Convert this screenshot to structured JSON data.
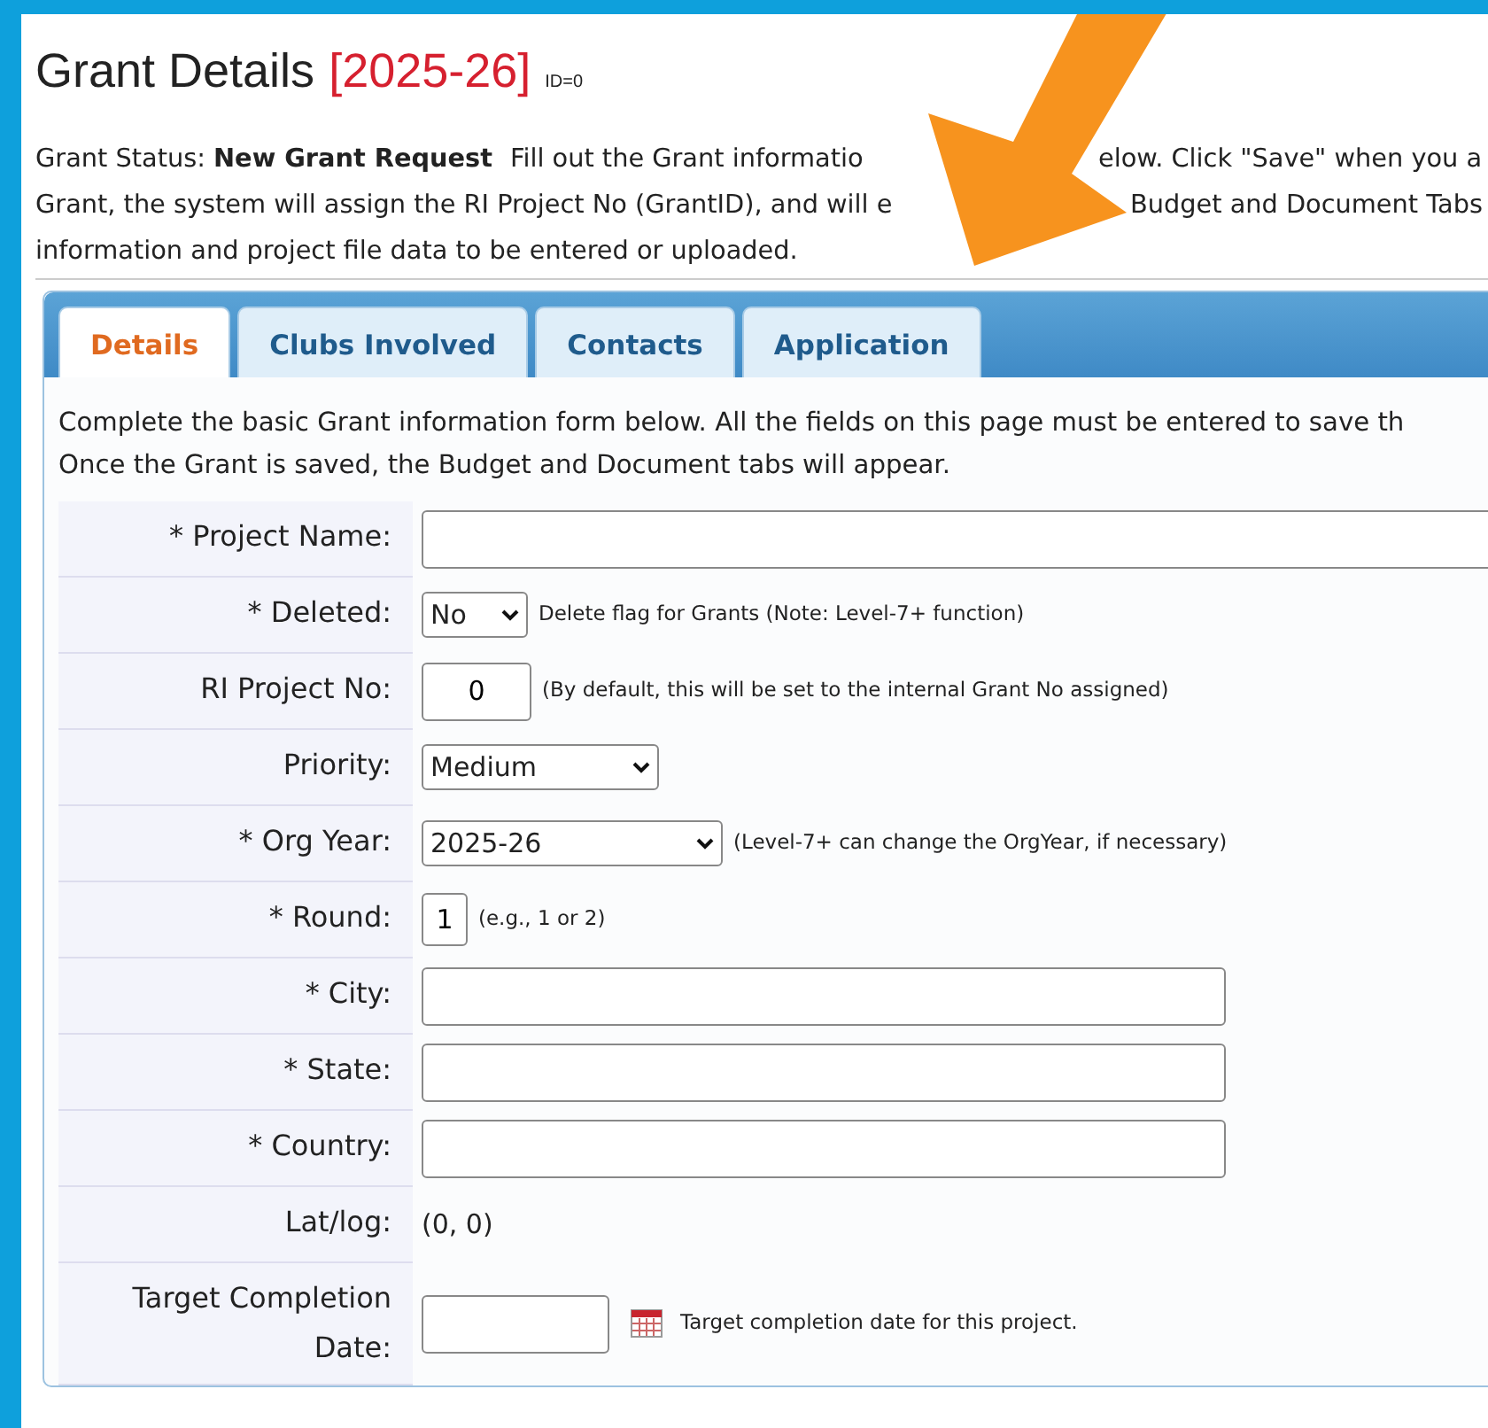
{
  "title": {
    "text": "Grant Details",
    "year": "[2025-26]",
    "id": "ID=0"
  },
  "intro": {
    "lines": [
      [
        {
          "text": "Grant Status: **New Grant Request**"
        },
        {
          "text": "Fill out the Grant informatio"
        },
        {
          "text": "elow. Click \"Save\" when you a"
        }
      ],
      [
        {
          "text": "Grant, the system will assign the RI Project No (GrantID), and will e"
        },
        {
          "text": "Budget and Document Tabs"
        }
      ],
      [
        {
          "text": "information and project file data to be entered or uploaded."
        }
      ]
    ]
  },
  "tabs": [
    {
      "label": "Details",
      "selected": true
    },
    {
      "label": "Clubs Involved",
      "selected": false
    },
    {
      "label": "Contacts",
      "selected": false
    },
    {
      "label": "Application",
      "selected": false
    }
  ],
  "panel_note": [
    "Complete the basic Grant information form below. All the fields on this page must be entered to save th",
    "Once the Grant is saved, the Budget and Document tabs will appear."
  ],
  "fields": [
    {
      "label": "* Project Name:",
      "kind": "text"
    },
    {
      "label": "* Deleted:",
      "kind": "select",
      "value": "No",
      "hint": "Delete flag for Grants (Note: Level-7+ function)"
    },
    {
      "label": "RI Project No:",
      "kind": "text",
      "value": "0",
      "hint": "(By default, this will be set to the internal Grant No assigned)"
    },
    {
      "label": "Priority:",
      "kind": "select",
      "value": "Medium"
    },
    {
      "label": "* Org Year:",
      "kind": "select",
      "value": "2025-26",
      "hint": "(Level-7+ can change the OrgYear, if necessary)"
    },
    {
      "label": "* Round:",
      "kind": "text",
      "value": "1",
      "hint": "(e.g., 1 or 2)"
    },
    {
      "label": "* City:",
      "kind": "text"
    },
    {
      "label": "* State:",
      "kind": "text"
    },
    {
      "label": "* Country:",
      "kind": "text"
    },
    {
      "label": "Lat/log:",
      "kind": "static",
      "value": "(0, 0)"
    },
    {
      "label": "Target Completion Date:",
      "kind": "date",
      "hint": "Target completion date for this project."
    }
  ],
  "annotation": {
    "kind": "arrow",
    "color": "#f7931e"
  }
}
